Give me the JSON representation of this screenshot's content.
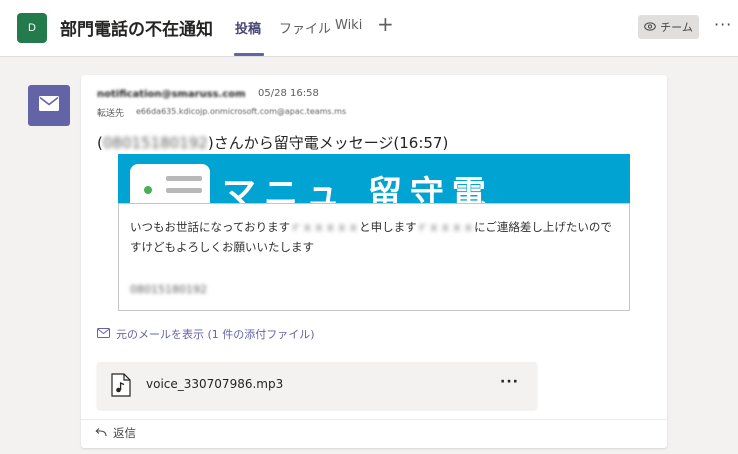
{
  "header": {
    "team_initial": "D",
    "channel_name": "部門電話の不在通知",
    "tabs": [
      {
        "label": "投稿",
        "active": true
      },
      {
        "label": "ファイル",
        "active": false
      },
      {
        "label": "Wiki",
        "active": false
      }
    ],
    "add_tab_symbol": "+",
    "team_button_label": "チーム",
    "more_symbol": "···"
  },
  "colors": {
    "accent": "#6264a7",
    "team_avatar": "#237b4b",
    "banner": "#00a3d1"
  },
  "post": {
    "sender": "notification@smaruss.com",
    "timestamp": "05/28 16:58",
    "forward_label": "転送先",
    "forward_address": "e66da635.kdicojp.onmicrosoft.com@apac.teams.ms",
    "subject_prefix": "(",
    "subject_number": "08015180192",
    "subject_suffix": ")さんから留守電メッセージ(16:57)",
    "banner_text": "マニュ 留守電",
    "body": {
      "segment_1": "いつもお世話になっております",
      "redacted_1": "ｒｘｘｘｘｘ",
      "segment_2": "と申します",
      "redacted_2": "ｒｘｘｘｘ",
      "segment_3": "にご連絡差し上げたいのですけどもよろしくお願いいたします",
      "phone_number": "08015180192"
    },
    "show_original_label": "元のメールを表示 (1 件の添付ファイル)",
    "attachment": {
      "file_name": "voice_330707986.mp3",
      "more_symbol": "···",
      "icon": "audio-file-icon"
    },
    "reply_label": "返信"
  }
}
